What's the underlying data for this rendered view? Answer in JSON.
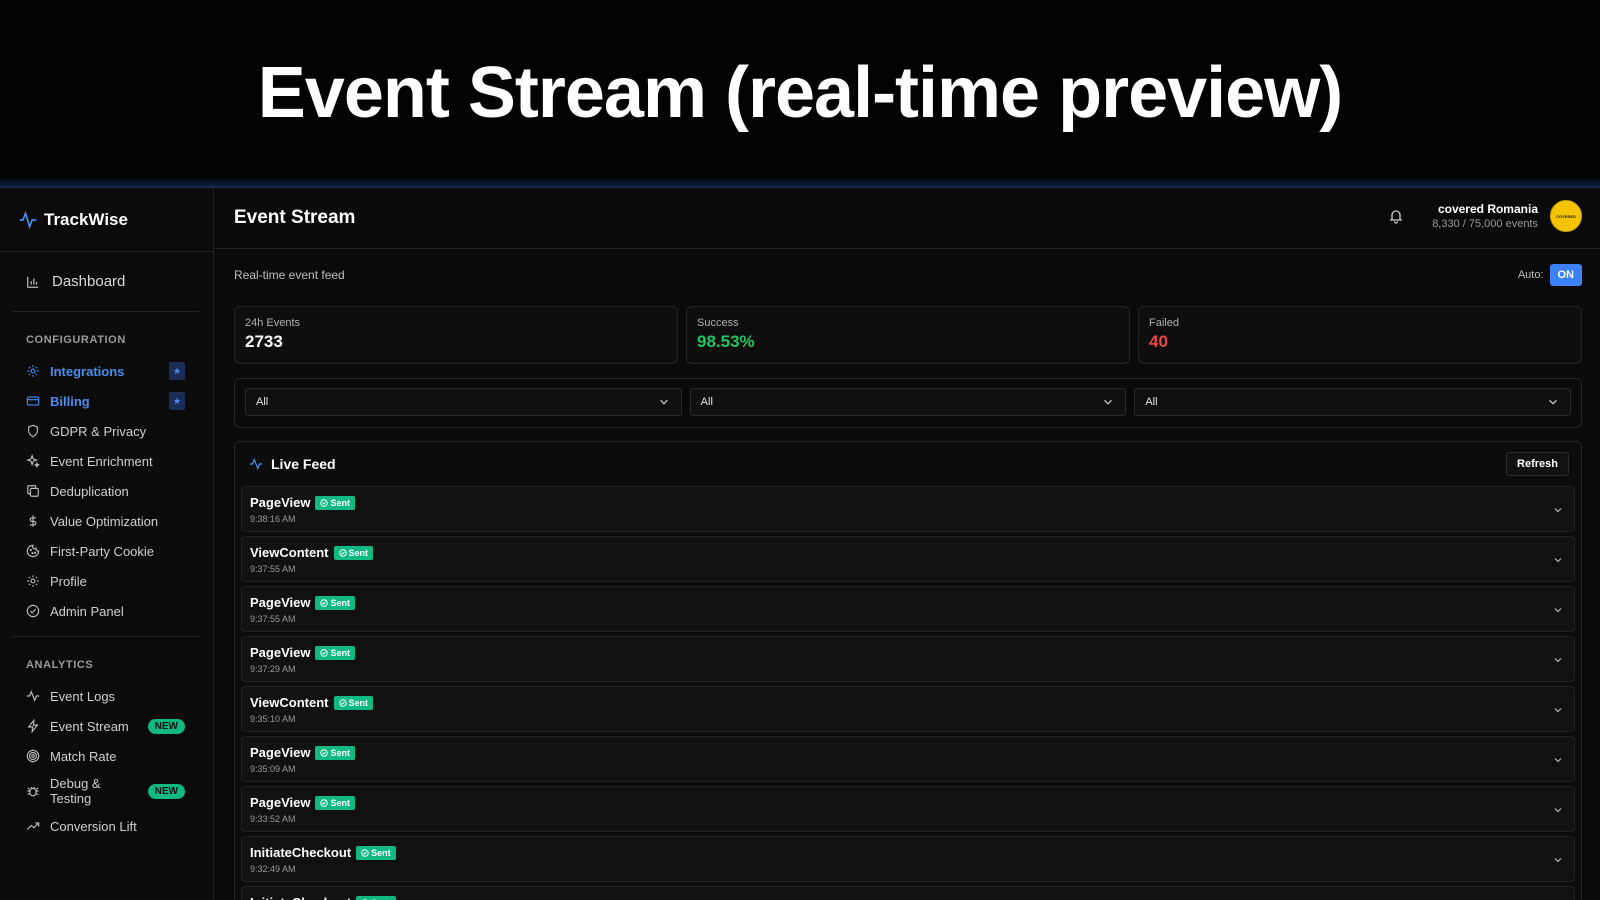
{
  "banner": {
    "title": "Event Stream (real-time preview)"
  },
  "brand": {
    "name": "TrackWise"
  },
  "sidebar": {
    "dashboard": "Dashboard",
    "config_label": "CONFIGURATION",
    "config_items": [
      {
        "label": "Integrations",
        "icon": "gear-icon",
        "badge": "★",
        "active": true
      },
      {
        "label": "Billing",
        "icon": "card-icon",
        "badge": "★",
        "active": true
      },
      {
        "label": "GDPR & Privacy",
        "icon": "shield-icon"
      },
      {
        "label": "Event Enrichment",
        "icon": "sparkle-icon"
      },
      {
        "label": "Deduplication",
        "icon": "copy-icon"
      },
      {
        "label": "Value Optimization",
        "icon": "dollar-icon"
      },
      {
        "label": "First-Party Cookie",
        "icon": "cookie-icon"
      },
      {
        "label": "Profile",
        "icon": "gear-icon"
      },
      {
        "label": "Admin Panel",
        "icon": "check-circle-icon"
      }
    ],
    "analytics_label": "ANALYTICS",
    "analytics_items": [
      {
        "label": "Event Logs",
        "icon": "activity-icon"
      },
      {
        "label": "Event Stream",
        "icon": "bolt-icon",
        "badge": "NEW"
      },
      {
        "label": "Match Rate",
        "icon": "target-icon"
      },
      {
        "label": "Debug &\nTesting",
        "icon": "bug-icon",
        "badge": "NEW"
      },
      {
        "label": "Conversion Lift",
        "icon": "trend-up-icon"
      }
    ]
  },
  "header": {
    "title": "Event Stream",
    "user_name": "covered Romania",
    "usage": "8,330 / 75,000 events",
    "avatar_text": "COVERED"
  },
  "main": {
    "subtitle": "Real-time event feed",
    "auto_label": "Auto:",
    "auto_state": "ON",
    "stats": [
      {
        "label": "24h Events",
        "value": "2733",
        "color": "#ffffff"
      },
      {
        "label": "Success",
        "value": "98.53%",
        "color": "#22c55e"
      },
      {
        "label": "Failed",
        "value": "40",
        "color": "#ef4444"
      }
    ],
    "filters": [
      "All",
      "All",
      "All"
    ],
    "feed": {
      "title": "Live Feed",
      "refresh": "Refresh",
      "status_label": "Sent",
      "events": [
        {
          "name": "PageView",
          "time": "9:38:16 AM"
        },
        {
          "name": "ViewContent",
          "time": "9:37:55 AM"
        },
        {
          "name": "PageView",
          "time": "9:37:55 AM"
        },
        {
          "name": "PageView",
          "time": "9:37:29 AM"
        },
        {
          "name": "ViewContent",
          "time": "9:35:10 AM"
        },
        {
          "name": "PageView",
          "time": "9:35:09 AM"
        },
        {
          "name": "PageView",
          "time": "9:33:52 AM"
        },
        {
          "name": "InitiateCheckout",
          "time": "9:32:49 AM"
        },
        {
          "name": "InitiateCheckout",
          "time": ""
        }
      ]
    }
  },
  "colors": {
    "accent": "#3b82f6",
    "success": "#10b981",
    "danger": "#ef4444"
  }
}
